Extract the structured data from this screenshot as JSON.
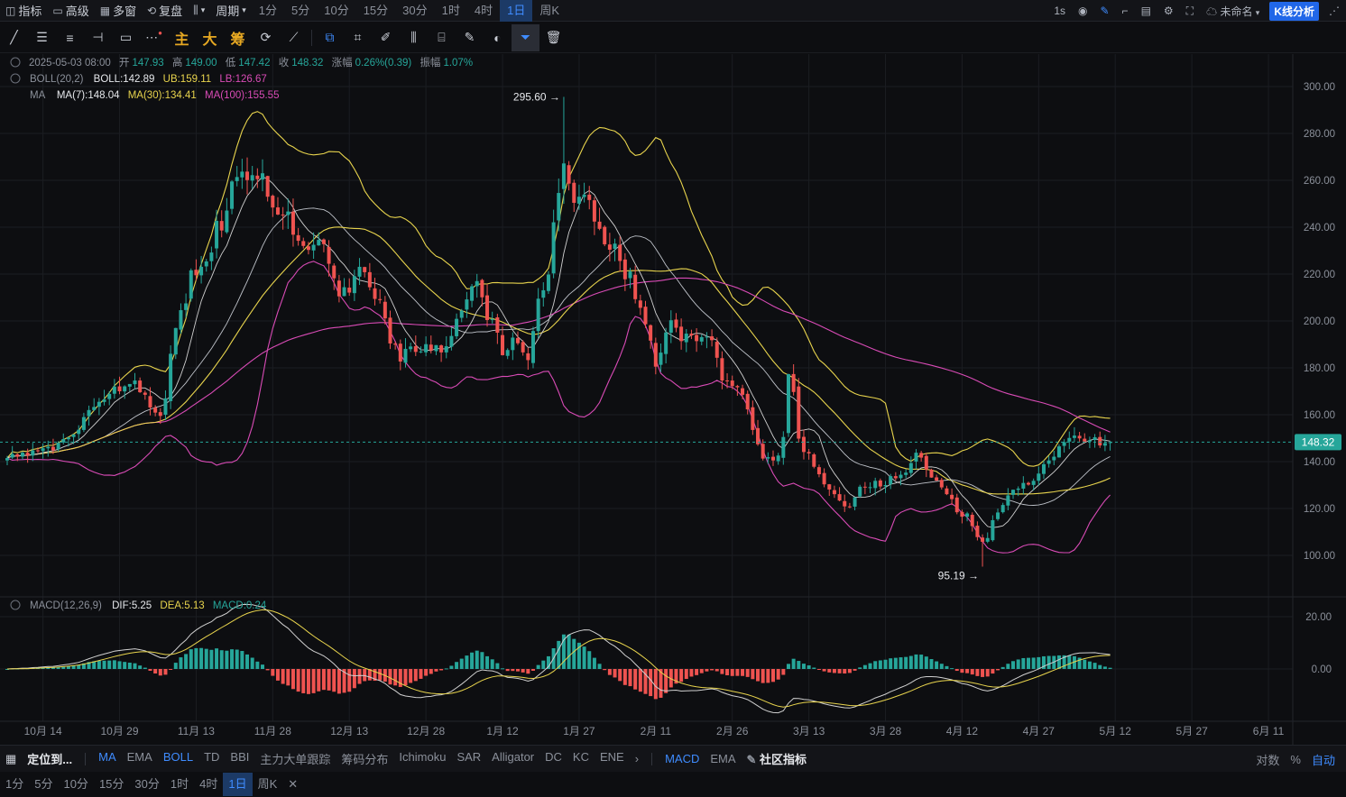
{
  "topbar": {
    "indicators": "指标",
    "advanced": "高级",
    "multi_window": "多窗",
    "replay": "复盘",
    "period": "周期",
    "timeframes": [
      "1分",
      "5分",
      "10分",
      "15分",
      "30分",
      "1时",
      "4时",
      "1日",
      "周K"
    ],
    "active_timeframe": "1日",
    "interval": "1s",
    "layout_name": "未命名",
    "kline_analysis": "K线分析"
  },
  "drawbar": {
    "main_label": "主",
    "big_label": "大",
    "chips_label": "筹"
  },
  "legend": {
    "ohlc": {
      "date": "2025-05-03 08:00",
      "open_label": "开",
      "open": "147.93",
      "high_label": "高",
      "high": "149.00",
      "low_label": "低",
      "low": "147.42",
      "close_label": "收",
      "close": "148.32",
      "chg_label": "涨幅",
      "chg": "0.26%(0.39)",
      "amp_label": "振幅",
      "amp": "1.07%"
    },
    "boll": {
      "name": "BOLL(20,2)",
      "mid": "BOLL:142.89",
      "ub": "UB:159.11",
      "lb": "LB:126.67"
    },
    "ma": {
      "name": "MA",
      "ma7": "MA(7):148.04",
      "ma30": "MA(30):134.41",
      "ma100": "MA(100):155.55"
    },
    "macd": {
      "name": "MACD(12,26,9)",
      "dif": "DIF:5.25",
      "dea": "DEA:5.13",
      "macd": "MACD:0.24"
    }
  },
  "annotations": {
    "high": "295.60",
    "low": "95.19"
  },
  "last_price": "148.32",
  "bottombar": {
    "locate": "定位到...",
    "main_indicators": [
      "MA",
      "EMA",
      "BOLL",
      "TD",
      "BBI",
      "主力大单跟踪",
      "筹码分布",
      "Ichimoku",
      "SAR",
      "Alligator",
      "DC",
      "KC",
      "ENE"
    ],
    "active_main": [
      "MA",
      "BOLL"
    ],
    "sub_indicators": [
      "MACD",
      "EMA"
    ],
    "active_sub": [
      "MACD"
    ],
    "community": "社区指标",
    "log": "对数",
    "percent": "%",
    "auto": "自动"
  },
  "colors": {
    "up": "#26a69a",
    "down": "#ef5350",
    "boll": "#e8d44d",
    "ma7": "#d0d0d0",
    "ma30": "#e8d44d",
    "ma100": "#d94bb6",
    "accent": "#3f8cff"
  },
  "chart_data": [
    {
      "type": "candlestick",
      "ylim": [
        88,
        305
      ],
      "yticks": [
        100,
        120,
        140,
        160,
        180,
        200,
        220,
        240,
        260,
        280,
        300
      ],
      "ytick_labels": [
        "100.00",
        "120.00",
        "140.00",
        "160.00",
        "180.00",
        "200.00",
        "220.00",
        "240.00",
        "260.00",
        "280.00",
        "300.00"
      ],
      "xtick_labels": [
        "10月 14",
        "10月 29",
        "11月 13",
        "11月 28",
        "12月 13",
        "12月 28",
        "1月 12",
        "1月 27",
        "2月 11",
        "2月 26",
        "3月 13",
        "3月 28",
        "4月 12",
        "4月 27",
        "5月 12",
        "5月 27",
        "6月 11"
      ],
      "xtick_candle_index": [
        7,
        22,
        37,
        52,
        67,
        82,
        97,
        112,
        127,
        142,
        157,
        172,
        187,
        202,
        217,
        232,
        247
      ],
      "last_price": 148.32,
      "close": [
        141.5,
        143.3,
        142.1,
        143.8,
        142.6,
        144.8,
        144.6,
        145.7,
        146.3,
        144.8,
        148.0,
        149.6,
        150.3,
        151.6,
        153.6,
        159.0,
        162.0,
        163.3,
        165.5,
        166.5,
        168.9,
        172.0,
        170.0,
        172.1,
        173.1,
        174.6,
        169.6,
        168.5,
        163.1,
        160.9,
        159.5,
        167.0,
        186.0,
        197.0,
        204.6,
        207.5,
        221.6,
        219.5,
        223.1,
        225.4,
        229.2,
        242.7,
        238.6,
        247.1,
        259.5,
        261.4,
        263.7,
        260.1,
        262.2,
        260.5,
        263.0,
        253.0,
        248.4,
        245.4,
        245.0,
        246.7,
        236.8,
        234.2,
        232.0,
        230.3,
        232.5,
        234.6,
        232.8,
        224.4,
        218.2,
        210.5,
        214.4,
        212.1,
        219.1,
        223.1,
        220.8,
        214.4,
        209.4,
        208.9,
        201.1,
        190.4,
        189.9,
        182.7,
        188.1,
        189.1,
        186.8,
        187.0,
        190.1,
        187.4,
        189.7,
        186.6,
        189.2,
        193.6,
        200.9,
        204.4,
        209.2,
        214.8,
        217.0,
        210.1,
        200.4,
        200.8,
        195.0,
        185.4,
        187.6,
        192.9,
        190.5,
        186.6,
        183.3,
        195.7,
        209.5,
        213.1,
        219.8,
        242.1,
        254.6,
        267.2,
        258.6,
        250.4,
        253.0,
        253.9,
        251.6,
        242.4,
        239.3,
        232.7,
        230.4,
        233.0,
        225.6,
        217.8,
        221.1,
        209.3,
        205.6,
        198.6,
        191.6,
        180.5,
        186.5,
        195.1,
        200.3,
        197.1,
        191.4,
        194.6,
        193.8,
        191.4,
        193.1,
        193.3,
        191.8,
        184.3,
        174.6,
        174.4,
        172.2,
        171.7,
        168.5,
        162.3,
        153.5,
        147.4,
        141.3,
        141.9,
        140.5,
        142.6,
        150.5,
        177.3,
        169.7,
        149.8,
        144.1,
        143.5,
        137.8,
        134.6,
        130.3,
        128.1,
        126.1,
        123.4,
        120.9,
        120.5,
        124.8,
        129.3,
        129.0,
        129.1,
        131.8,
        129.4,
        130.0,
        133.8,
        132.9,
        134.4,
        135.3,
        139.4,
        143.8,
        141.7,
        136.6,
        133.2,
        131.9,
        129.0,
        126.1,
        124.0,
        118.4,
        116.5,
        117.9,
        112.5,
        107.8,
        105.8,
        107.4,
        115.0,
        118.3,
        121.5,
        125.6,
        128.0,
        128.5,
        130.9,
        130.2,
        131.8,
        134.9,
        138.9,
        140.5,
        142.1,
        146.5,
        148.3,
        150.1,
        151.1,
        149.9,
        148.5,
        149.1,
        150.4,
        146.9,
        147.9,
        148.3
      ]
    },
    {
      "type": "macd",
      "ylim": [
        -10,
        25
      ],
      "yticks": [
        0,
        20
      ],
      "ytick_labels": [
        "0.00",
        "20.00"
      ],
      "params": [
        12,
        26,
        9
      ]
    }
  ]
}
